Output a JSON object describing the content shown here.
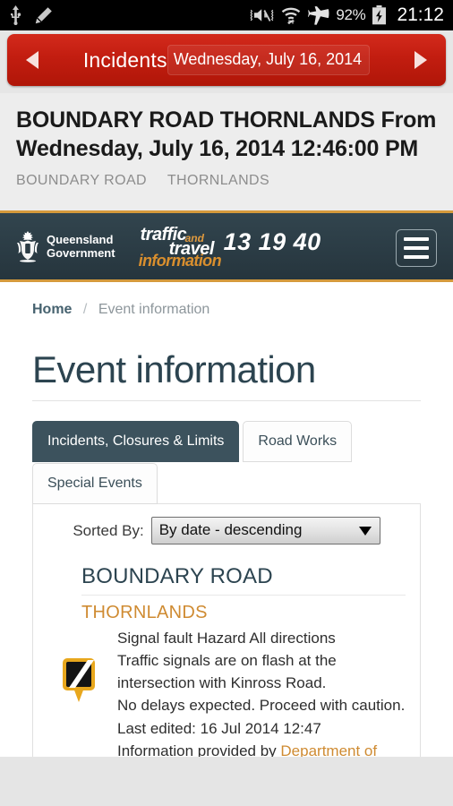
{
  "statusbar": {
    "icons_left": [
      "usb-icon",
      "edit-pencil-icon"
    ],
    "icons_right": [
      "mute-vibrate-icon",
      "wifi-icon",
      "airplane-mode-icon",
      "battery-charging-icon"
    ],
    "battery_percent": "92%",
    "clock": "21:12"
  },
  "appbar": {
    "prev_label": "◀",
    "next_label": "▶",
    "title": "Incidents",
    "date": "Wednesday, July 16, 2014"
  },
  "event": {
    "title": "BOUNDARY ROAD THORNLANDS From Wednesday, July 16, 2014 12:46:00 PM",
    "road": "BOUNDARY ROAD",
    "suburb": "THORNLANDS"
  },
  "site": {
    "logo_line1": "Queensland",
    "logo_line2": "Government",
    "brand": {
      "traffic": "traffic",
      "and": "and",
      "travel": "travel",
      "information": "information",
      "phone": "13 19 40"
    },
    "menu_label": "menu"
  },
  "breadcrumb": {
    "home": "Home",
    "separator": "/",
    "current": "Event information"
  },
  "page": {
    "heading": "Event information"
  },
  "tabs": [
    {
      "label": "Incidents, Closures & Limits",
      "active": true
    },
    {
      "label": "Road Works",
      "active": false
    },
    {
      "label": "Special Events",
      "active": false
    }
  ],
  "sort": {
    "label": "Sorted By:",
    "selected": "By date - descending",
    "options": [
      "By date - descending"
    ]
  },
  "incident": {
    "road": "BOUNDARY ROAD",
    "suburb": "THORNLANDS",
    "icon": "hazard-pin-icon",
    "line1": "Signal fault Hazard All directions",
    "line2": "Traffic signals are on flash at the intersection with Kinross Road.",
    "line3": "No delays expected. Proceed with caution.",
    "line4": "Last edited: 16 Jul 2014 12:47",
    "line5_prefix": "Information provided by ",
    "line5_link": "Department of"
  },
  "colors": {
    "appbar_red": "#c21d10",
    "site_dark": "#2b3c45",
    "accent_orange": "#d59a3c",
    "heading_slate": "#2c4450",
    "page_bg": "#e5e5e5"
  }
}
